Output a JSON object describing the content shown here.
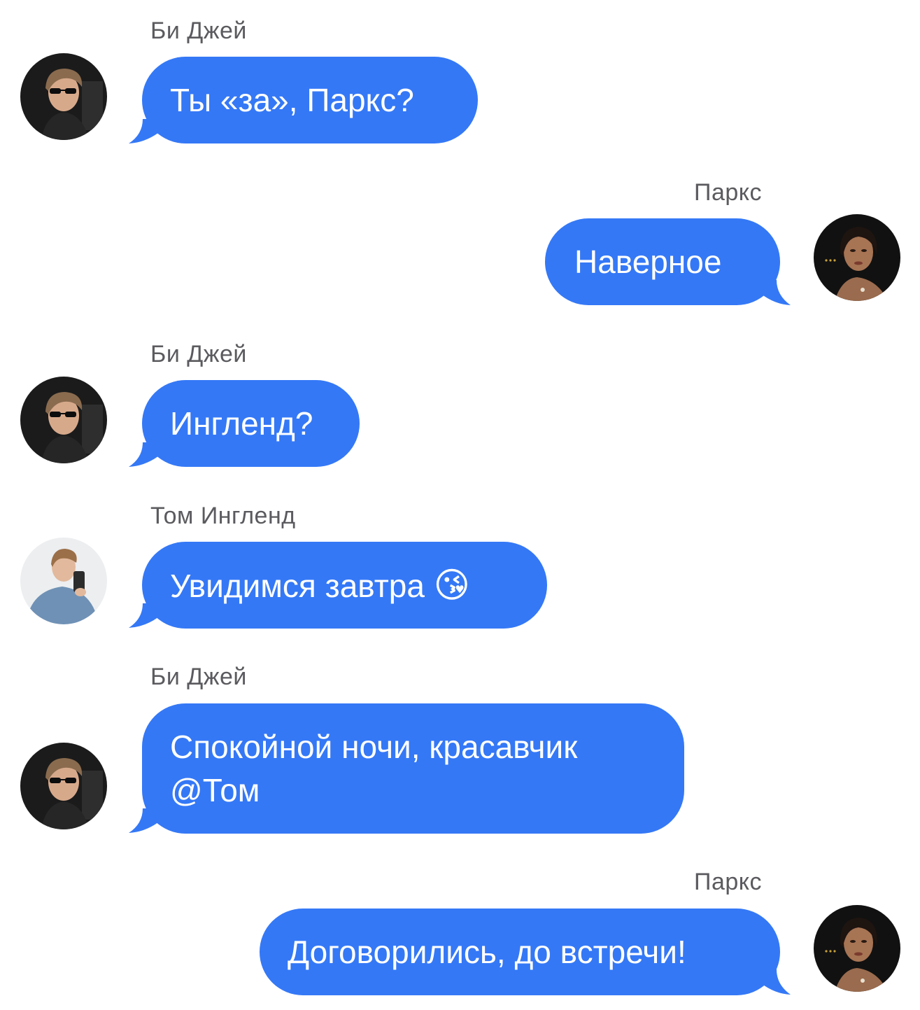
{
  "chat": {
    "messages": [
      {
        "sender": "Би Джей",
        "text": "Ты «за», Паркс?"
      },
      {
        "sender": "Паркс",
        "text": "Наверное"
      },
      {
        "sender": "Би Джей",
        "text": "Ингленд?"
      },
      {
        "sender": "Том Ингленд",
        "text": "Увидимся завтра",
        "emoji": "😘"
      },
      {
        "sender": "Би Джей",
        "text_line1": "Спокойной ночи, красавчик",
        "text_line2": "@Том"
      },
      {
        "sender": "Паркс",
        "text": "Договорились, до встречи!"
      }
    ]
  },
  "colors": {
    "bubble": "#3478f6",
    "sender_text": "#5b5b5f",
    "background": "#ffffff"
  },
  "avatars": {
    "bi_jay": "avatar-bi-jay",
    "parks": "avatar-parks",
    "tom_england": "avatar-tom-england"
  }
}
